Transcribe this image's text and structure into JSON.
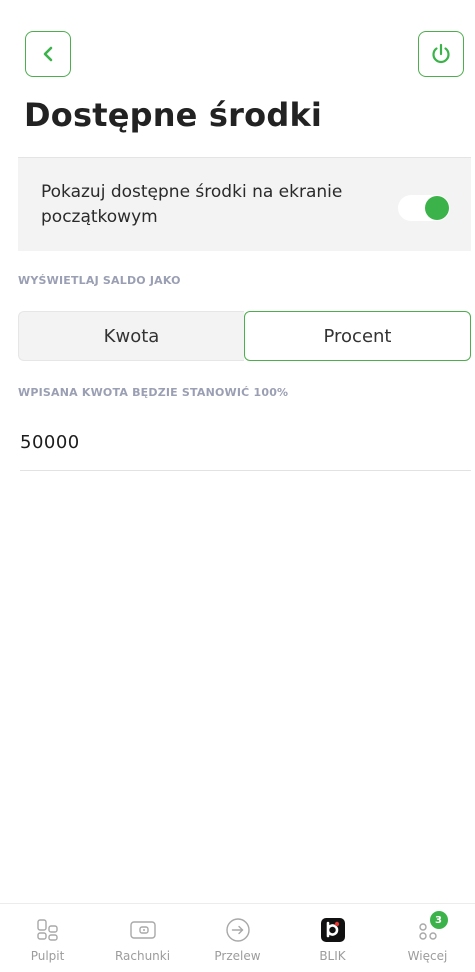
{
  "header": {
    "title": "Dostępne środki"
  },
  "toggle": {
    "label": "Pokazuj dostępne środki na ekranie początkowym",
    "state": "on"
  },
  "balance_mode": {
    "section_label": "WYŚWIETLAJ SALDO JAKO",
    "options": [
      "Kwota",
      "Procent"
    ],
    "selected": "Procent"
  },
  "amount": {
    "section_label": "WPISANA KWOTA BĘDZIE STANOWIĆ 100%",
    "value": "50000"
  },
  "tabbar": {
    "items": [
      {
        "label": "Pulpit",
        "icon": "grid-icon"
      },
      {
        "label": "Rachunki",
        "icon": "wallet-icon"
      },
      {
        "label": "Przelew",
        "icon": "arrow-circle-icon"
      },
      {
        "label": "BLIK",
        "icon": "blik-icon"
      },
      {
        "label": "Więcej",
        "icon": "more-icon",
        "badge": "3"
      }
    ]
  },
  "colors": {
    "accent": "#3cb34a",
    "border_accent": "#4cae4c",
    "muted_label": "#9a9fb3"
  }
}
